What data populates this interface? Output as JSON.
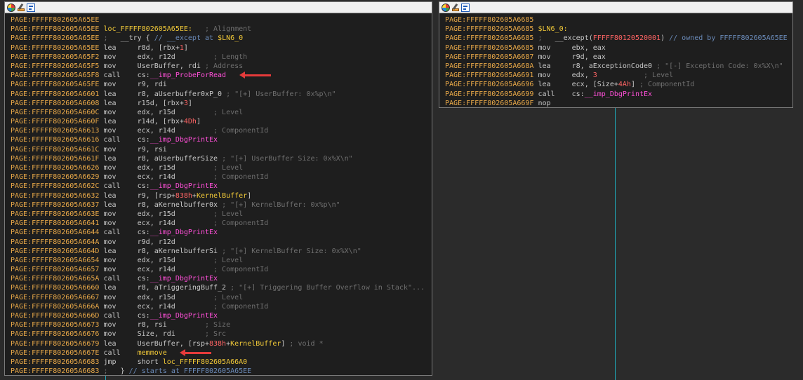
{
  "left_panel": {
    "toolbar_icons": [
      "color-palette-icon",
      "edit-node-icon",
      "graph-overview-icon"
    ],
    "lines": [
      {
        "addr": "PAGE:FFFFF802605A65EE",
        "spans": []
      },
      {
        "addr": "PAGE:FFFFF802605A65EE",
        "spans": [
          {
            "c": "lbl",
            "t": "loc_FFFFF802605A65EE:"
          },
          {
            "c": "cm",
            "t": "   ; Alignment"
          }
        ]
      },
      {
        "addr": "PAGE:FFFFF802605A65EE",
        "spans": [
          {
            "c": "cm",
            "t": ";   "
          },
          {
            "c": "op",
            "t": "__try { "
          },
          {
            "c": "cmh",
            "t": "// __except at "
          },
          {
            "c": "lbl",
            "t": "$LN6_0"
          }
        ]
      },
      {
        "addr": "PAGE:FFFFF802605A65EE",
        "spans": [
          {
            "c": "mn",
            "t": "lea     "
          },
          {
            "c": "op",
            "t": "r8d, [rbx+"
          },
          {
            "c": "num",
            "t": "1"
          },
          {
            "c": "op",
            "t": "]"
          }
        ]
      },
      {
        "addr": "PAGE:FFFFF802605A65F2",
        "spans": [
          {
            "c": "mn",
            "t": "mov     "
          },
          {
            "c": "op",
            "t": "edx, r12d         "
          },
          {
            "c": "cm",
            "t": "; Length"
          }
        ]
      },
      {
        "addr": "PAGE:FFFFF802605A65F5",
        "spans": [
          {
            "c": "mn",
            "t": "mov     "
          },
          {
            "c": "op",
            "t": "UserBuffer, rdi "
          },
          {
            "c": "cm",
            "t": "; Address"
          }
        ]
      },
      {
        "addr": "PAGE:FFFFF802605A65F8",
        "spans": [
          {
            "c": "mn",
            "t": "call    "
          },
          {
            "c": "op",
            "t": "cs:"
          },
          {
            "c": "fn",
            "t": "__imp_ProbeForRead"
          }
        ],
        "arrow": true
      },
      {
        "addr": "PAGE:FFFFF802605A65FE",
        "spans": [
          {
            "c": "mn",
            "t": "mov     "
          },
          {
            "c": "op",
            "t": "r9, rdi"
          }
        ]
      },
      {
        "addr": "PAGE:FFFFF802605A6601",
        "spans": [
          {
            "c": "mn",
            "t": "lea     "
          },
          {
            "c": "op",
            "t": "r8, aUserbuffer0xP_0 "
          },
          {
            "c": "cm",
            "t": "; \"[+] UserBuffer: 0x%p\\n\""
          }
        ]
      },
      {
        "addr": "PAGE:FFFFF802605A6608",
        "spans": [
          {
            "c": "mn",
            "t": "lea     "
          },
          {
            "c": "op",
            "t": "r15d, [rbx+"
          },
          {
            "c": "num",
            "t": "3"
          },
          {
            "c": "op",
            "t": "]"
          }
        ]
      },
      {
        "addr": "PAGE:FFFFF802605A660C",
        "spans": [
          {
            "c": "mn",
            "t": "mov     "
          },
          {
            "c": "op",
            "t": "edx, r15d         "
          },
          {
            "c": "cm",
            "t": "; Level"
          }
        ]
      },
      {
        "addr": "PAGE:FFFFF802605A660F",
        "spans": [
          {
            "c": "mn",
            "t": "lea     "
          },
          {
            "c": "op",
            "t": "r14d, [rbx+"
          },
          {
            "c": "num",
            "t": "4Dh"
          },
          {
            "c": "op",
            "t": "]"
          }
        ]
      },
      {
        "addr": "PAGE:FFFFF802605A6613",
        "spans": [
          {
            "c": "mn",
            "t": "mov     "
          },
          {
            "c": "op",
            "t": "ecx, r14d         "
          },
          {
            "c": "cm",
            "t": "; ComponentId"
          }
        ]
      },
      {
        "addr": "PAGE:FFFFF802605A6616",
        "spans": [
          {
            "c": "mn",
            "t": "call    "
          },
          {
            "c": "op",
            "t": "cs:"
          },
          {
            "c": "fn",
            "t": "__imp_DbgPrintEx"
          }
        ]
      },
      {
        "addr": "PAGE:FFFFF802605A661C",
        "spans": [
          {
            "c": "mn",
            "t": "mov     "
          },
          {
            "c": "op",
            "t": "r9, rsi"
          }
        ]
      },
      {
        "addr": "PAGE:FFFFF802605A661F",
        "spans": [
          {
            "c": "mn",
            "t": "lea     "
          },
          {
            "c": "op",
            "t": "r8, aUserbufferSize "
          },
          {
            "c": "cm",
            "t": "; \"[+] UserBuffer Size: 0x%X\\n\""
          }
        ]
      },
      {
        "addr": "PAGE:FFFFF802605A6626",
        "spans": [
          {
            "c": "mn",
            "t": "mov     "
          },
          {
            "c": "op",
            "t": "edx, r15d         "
          },
          {
            "c": "cm",
            "t": "; Level"
          }
        ]
      },
      {
        "addr": "PAGE:FFFFF802605A6629",
        "spans": [
          {
            "c": "mn",
            "t": "mov     "
          },
          {
            "c": "op",
            "t": "ecx, r14d         "
          },
          {
            "c": "cm",
            "t": "; ComponentId"
          }
        ]
      },
      {
        "addr": "PAGE:FFFFF802605A662C",
        "spans": [
          {
            "c": "mn",
            "t": "call    "
          },
          {
            "c": "op",
            "t": "cs:"
          },
          {
            "c": "fn",
            "t": "__imp_DbgPrintEx"
          }
        ]
      },
      {
        "addr": "PAGE:FFFFF802605A6632",
        "spans": [
          {
            "c": "mn",
            "t": "lea     "
          },
          {
            "c": "op",
            "t": "r9, [rsp+"
          },
          {
            "c": "num",
            "t": "838h"
          },
          {
            "c": "op",
            "t": "+"
          },
          {
            "c": "lbl",
            "t": "KernelBuffer"
          },
          {
            "c": "op",
            "t": "]"
          }
        ]
      },
      {
        "addr": "PAGE:FFFFF802605A6637",
        "spans": [
          {
            "c": "mn",
            "t": "lea     "
          },
          {
            "c": "op",
            "t": "r8, aKernelbuffer0x "
          },
          {
            "c": "cm",
            "t": "; \"[+] KernelBuffer: 0x%p\\n\""
          }
        ]
      },
      {
        "addr": "PAGE:FFFFF802605A663E",
        "spans": [
          {
            "c": "mn",
            "t": "mov     "
          },
          {
            "c": "op",
            "t": "edx, r15d         "
          },
          {
            "c": "cm",
            "t": "; Level"
          }
        ]
      },
      {
        "addr": "PAGE:FFFFF802605A6641",
        "spans": [
          {
            "c": "mn",
            "t": "mov     "
          },
          {
            "c": "op",
            "t": "ecx, r14d         "
          },
          {
            "c": "cm",
            "t": "; ComponentId"
          }
        ]
      },
      {
        "addr": "PAGE:FFFFF802605A6644",
        "spans": [
          {
            "c": "mn",
            "t": "call    "
          },
          {
            "c": "op",
            "t": "cs:"
          },
          {
            "c": "fn",
            "t": "__imp_DbgPrintEx"
          }
        ]
      },
      {
        "addr": "PAGE:FFFFF802605A664A",
        "spans": [
          {
            "c": "mn",
            "t": "mov     "
          },
          {
            "c": "op",
            "t": "r9d, r12d"
          }
        ]
      },
      {
        "addr": "PAGE:FFFFF802605A664D",
        "spans": [
          {
            "c": "mn",
            "t": "lea     "
          },
          {
            "c": "op",
            "t": "r8, aKernelbufferSi "
          },
          {
            "c": "cm",
            "t": "; \"[+] KernelBuffer Size: 0x%X\\n\""
          }
        ]
      },
      {
        "addr": "PAGE:FFFFF802605A6654",
        "spans": [
          {
            "c": "mn",
            "t": "mov     "
          },
          {
            "c": "op",
            "t": "edx, r15d         "
          },
          {
            "c": "cm",
            "t": "; Level"
          }
        ]
      },
      {
        "addr": "PAGE:FFFFF802605A6657",
        "spans": [
          {
            "c": "mn",
            "t": "mov     "
          },
          {
            "c": "op",
            "t": "ecx, r14d         "
          },
          {
            "c": "cm",
            "t": "; ComponentId"
          }
        ]
      },
      {
        "addr": "PAGE:FFFFF802605A665A",
        "spans": [
          {
            "c": "mn",
            "t": "call    "
          },
          {
            "c": "op",
            "t": "cs:"
          },
          {
            "c": "fn",
            "t": "__imp_DbgPrintEx"
          }
        ]
      },
      {
        "addr": "PAGE:FFFFF802605A6660",
        "spans": [
          {
            "c": "mn",
            "t": "lea     "
          },
          {
            "c": "op",
            "t": "r8, aTriggeringBuff_2 "
          },
          {
            "c": "cm",
            "t": "; \"[+] Triggering Buffer Overflow in Stack\"..."
          }
        ]
      },
      {
        "addr": "PAGE:FFFFF802605A6667",
        "spans": [
          {
            "c": "mn",
            "t": "mov     "
          },
          {
            "c": "op",
            "t": "edx, r15d         "
          },
          {
            "c": "cm",
            "t": "; Level"
          }
        ]
      },
      {
        "addr": "PAGE:FFFFF802605A666A",
        "spans": [
          {
            "c": "mn",
            "t": "mov     "
          },
          {
            "c": "op",
            "t": "ecx, r14d         "
          },
          {
            "c": "cm",
            "t": "; ComponentId"
          }
        ]
      },
      {
        "addr": "PAGE:FFFFF802605A666D",
        "spans": [
          {
            "c": "mn",
            "t": "call    "
          },
          {
            "c": "op",
            "t": "cs:"
          },
          {
            "c": "fn",
            "t": "__imp_DbgPrintEx"
          }
        ]
      },
      {
        "addr": "PAGE:FFFFF802605A6673",
        "spans": [
          {
            "c": "mn",
            "t": "mov     "
          },
          {
            "c": "op",
            "t": "r8, rsi         "
          },
          {
            "c": "cm",
            "t": "; Size"
          }
        ]
      },
      {
        "addr": "PAGE:FFFFF802605A6676",
        "spans": [
          {
            "c": "mn",
            "t": "mov     "
          },
          {
            "c": "op",
            "t": "Size, rdi       "
          },
          {
            "c": "cm",
            "t": "; Src"
          }
        ]
      },
      {
        "addr": "PAGE:FFFFF802605A6679",
        "spans": [
          {
            "c": "mn",
            "t": "lea     "
          },
          {
            "c": "op",
            "t": "UserBuffer, [rsp+"
          },
          {
            "c": "num",
            "t": "838h"
          },
          {
            "c": "op",
            "t": "+"
          },
          {
            "c": "lbl",
            "t": "KernelBuffer"
          },
          {
            "c": "op",
            "t": "] "
          },
          {
            "c": "cm",
            "t": "; void *"
          }
        ]
      },
      {
        "addr": "PAGE:FFFFF802605A667E",
        "spans": [
          {
            "c": "mn",
            "t": "call    "
          },
          {
            "c": "lbl",
            "t": "memmove"
          }
        ],
        "arrow": true
      },
      {
        "addr": "PAGE:FFFFF802605A6683",
        "spans": [
          {
            "c": "mn",
            "t": "jmp     "
          },
          {
            "c": "op",
            "t": "short "
          },
          {
            "c": "lbl",
            "t": "loc_FFFFF802605A66A0"
          }
        ]
      },
      {
        "addr": "PAGE:FFFFF802605A6683",
        "spans": [
          {
            "c": "cm",
            "t": ";   "
          },
          {
            "c": "op",
            "t": "} "
          },
          {
            "c": "cmh",
            "t": "// starts at FFFFF802605A65EE"
          }
        ]
      }
    ]
  },
  "right_panel": {
    "toolbar_icons": [
      "color-palette-icon",
      "edit-node-icon",
      "graph-overview-icon"
    ],
    "lines": [
      {
        "addr": "PAGE:FFFFF802605A6685",
        "spans": []
      },
      {
        "addr": "PAGE:FFFFF802605A6685",
        "spans": [
          {
            "c": "lbl",
            "t": "$LN6_0:"
          }
        ]
      },
      {
        "addr": "PAGE:FFFFF802605A6685",
        "spans": [
          {
            "c": "cm",
            "t": ";   "
          },
          {
            "c": "op",
            "t": "__except("
          },
          {
            "c": "num",
            "t": "FFFFF80120520001"
          },
          {
            "c": "op",
            "t": ") "
          },
          {
            "c": "cmh",
            "t": "// owned by FFFFF802605A65EE"
          }
        ]
      },
      {
        "addr": "PAGE:FFFFF802605A6685",
        "spans": [
          {
            "c": "mn",
            "t": "mov     "
          },
          {
            "c": "op",
            "t": "ebx, eax"
          }
        ]
      },
      {
        "addr": "PAGE:FFFFF802605A6687",
        "spans": [
          {
            "c": "mn",
            "t": "mov     "
          },
          {
            "c": "op",
            "t": "r9d, eax"
          }
        ]
      },
      {
        "addr": "PAGE:FFFFF802605A668A",
        "spans": [
          {
            "c": "mn",
            "t": "lea     "
          },
          {
            "c": "op",
            "t": "r8, aExceptionCode0 "
          },
          {
            "c": "cm",
            "t": "; \"[-] Exception Code: 0x%X\\n\""
          }
        ]
      },
      {
        "addr": "PAGE:FFFFF802605A6691",
        "spans": [
          {
            "c": "mn",
            "t": "mov     "
          },
          {
            "c": "op",
            "t": "edx, "
          },
          {
            "c": "num",
            "t": "3"
          },
          {
            "c": "op",
            "t": "           "
          },
          {
            "c": "cm",
            "t": "; Level"
          }
        ]
      },
      {
        "addr": "PAGE:FFFFF802605A6696",
        "spans": [
          {
            "c": "mn",
            "t": "lea     "
          },
          {
            "c": "op",
            "t": "ecx, [Size+"
          },
          {
            "c": "num",
            "t": "4Ah"
          },
          {
            "c": "op",
            "t": "] "
          },
          {
            "c": "cm",
            "t": "; ComponentId"
          }
        ]
      },
      {
        "addr": "PAGE:FFFFF802605A6699",
        "spans": [
          {
            "c": "mn",
            "t": "call    "
          },
          {
            "c": "op",
            "t": "cs:"
          },
          {
            "c": "fn",
            "t": "__imp_DbgPrintEx"
          }
        ]
      },
      {
        "addr": "PAGE:FFFFF802605A669F",
        "spans": [
          {
            "c": "mn",
            "t": "nop"
          }
        ]
      }
    ]
  },
  "colors": {
    "background": "#2b2b2b",
    "panel": "#1e1e1e",
    "address": "#e8a848",
    "label": "#f0c838",
    "import_function": "#ff4fd8",
    "number": "#ff6464",
    "comment": "#6f6f6f",
    "arrow": "#e53b3b",
    "edge_line": "#1fa8b8"
  }
}
